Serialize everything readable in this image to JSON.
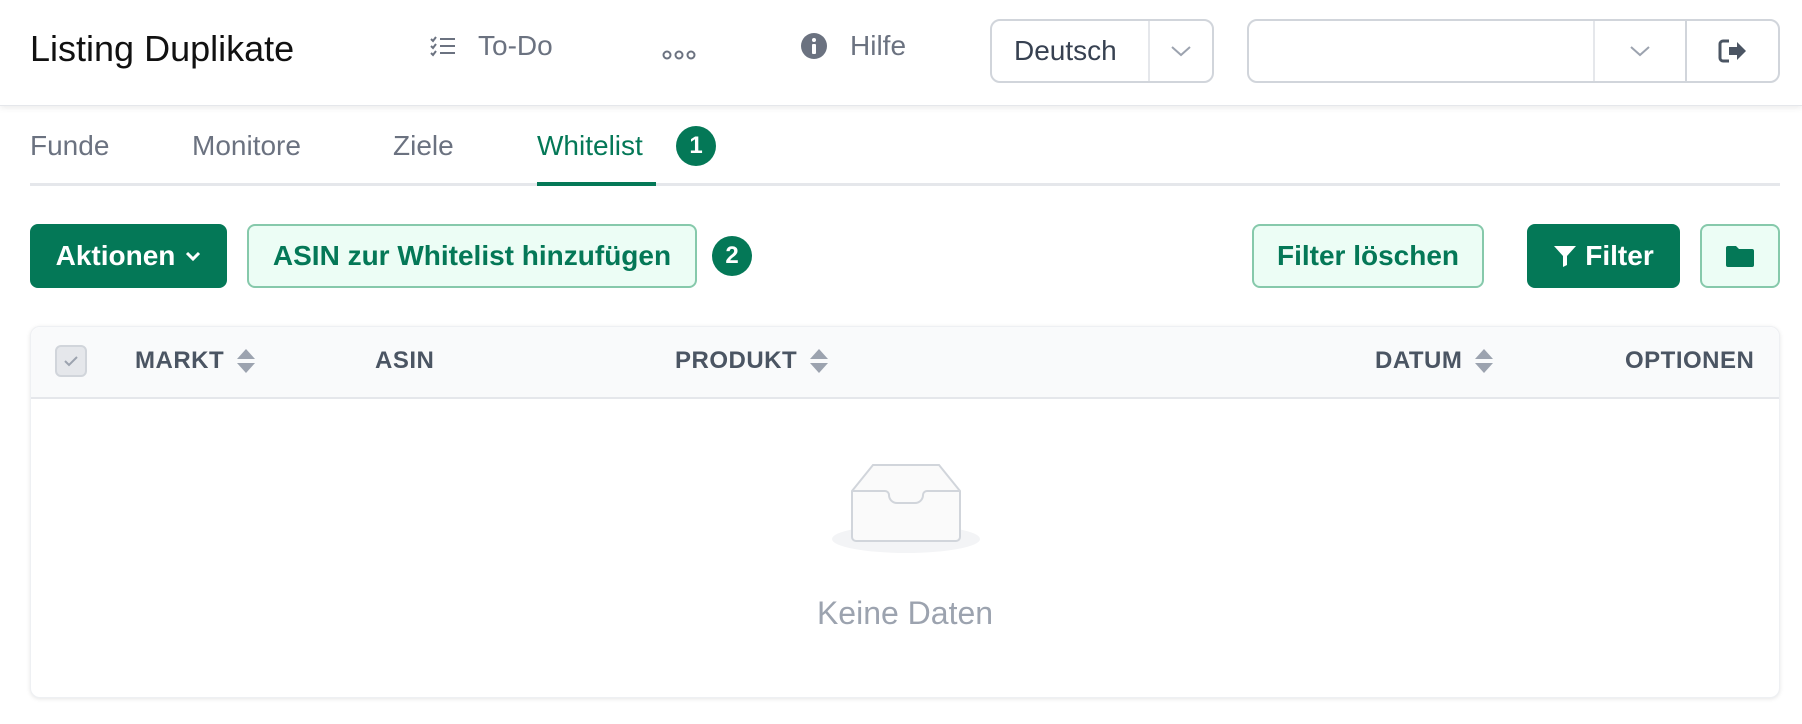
{
  "header": {
    "title": "Listing Duplikate",
    "todo_label": "To-Do",
    "more_label": "∘∘∘",
    "help_label": "Hilfe",
    "language": {
      "selected": "Deutsch"
    },
    "account": {
      "selected": ""
    }
  },
  "tabs": [
    {
      "label": "Funde",
      "active": false
    },
    {
      "label": "Monitore",
      "active": false
    },
    {
      "label": "Ziele",
      "active": false
    },
    {
      "label": "Whitelist",
      "active": true
    }
  ],
  "badges": {
    "tab_badge": "1",
    "toolbar_badge": "2"
  },
  "toolbar": {
    "actions_label": "Aktionen",
    "add_label": "ASIN zur Whitelist hinzufügen",
    "clear_filter_label": "Filter löschen",
    "filter_label": "Filter"
  },
  "table": {
    "columns": [
      "MARKT",
      "ASIN",
      "PRODUKT",
      "DATUM",
      "OPTIONEN"
    ],
    "empty_text": "Keine Daten"
  },
  "colors": {
    "primary": "#047857",
    "primary_light": "#ecfdf5",
    "muted_text": "#6b7280"
  },
  "icons": [
    "checklist-icon",
    "more-icon",
    "info-icon",
    "chevron-down-icon",
    "logout-icon",
    "filter-icon",
    "folder-icon",
    "sort-icon",
    "inbox-icon"
  ]
}
